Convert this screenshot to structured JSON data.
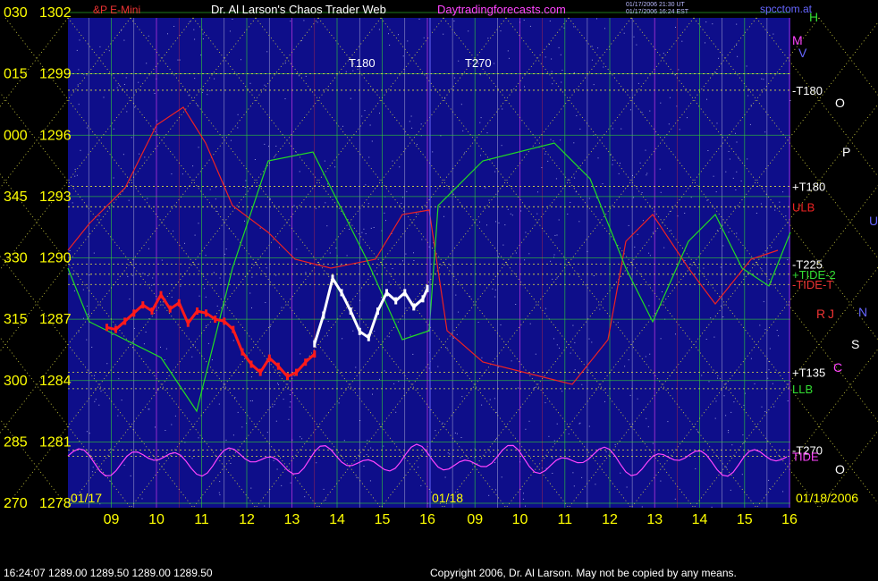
{
  "header": {
    "symbol": "&P E-Mini",
    "title": "Dr. Al Larson's Chaos Trader Web",
    "site": "Daytradingforecasts.com",
    "stamp1": "01/17/2006 21:30 UT",
    "stamp2": "01/17/2006 16:24 EST",
    "corner": "spcctom.at"
  },
  "footer": {
    "quote": "16:24:07  1289.00  1289.50  1289.00  1289.50",
    "copyright": "Copyright 2006, Dr. Al Larson. May not be copied by any means."
  },
  "colors": {
    "background": "#000000",
    "plot_bg": "#0e0e8a",
    "axis_text": "#ffff00",
    "price_red": "#ff1a1a",
    "price_white": "#ffffff",
    "tide_green": "#22dd22",
    "tide_red": "#ee2222",
    "magenta": "#ff44ff",
    "grid_yellow": "#dddd44"
  },
  "chart_data": {
    "type": "line",
    "title": "Dr. Al Larson's Chaos Trader Web",
    "y_axis": {
      "ylim": [
        1278,
        1302
      ],
      "ticks": [
        {
          "deg": "030",
          "price": "1302",
          "value": 1302
        },
        {
          "deg": "015",
          "price": "1299",
          "value": 1299
        },
        {
          "deg": "000",
          "price": "1296",
          "value": 1296
        },
        {
          "deg": "345",
          "price": "1293",
          "value": 1293
        },
        {
          "deg": "330",
          "price": "1290",
          "value": 1290
        },
        {
          "deg": "315",
          "price": "1287",
          "value": 1287
        },
        {
          "deg": "300",
          "price": "1284",
          "value": 1284
        },
        {
          "deg": "285",
          "price": "1281",
          "value": 1281
        },
        {
          "deg": "270",
          "price": "1278",
          "value": 1278
        }
      ]
    },
    "x_axis": {
      "days": [
        "01/17",
        "01/18"
      ],
      "end_date": "01/18/2006",
      "hours_day1": [
        "09",
        "10",
        "11",
        "12",
        "13",
        "14",
        "15",
        "16"
      ],
      "hours_day2": [
        "09",
        "10",
        "11",
        "12",
        "13",
        "14",
        "15",
        "16"
      ]
    },
    "series": [
      {
        "color": "#ff1a1a",
        "x": [
          8.9,
          9.1,
          9.3,
          9.5,
          9.7,
          9.9,
          10.1,
          10.3,
          10.5,
          10.7,
          10.9,
          11.1,
          11.3,
          11.5,
          11.7,
          11.9,
          12.1,
          12.3,
          12.5,
          12.7,
          12.9,
          13.1,
          13.3,
          13.5
        ],
        "y": [
          1286.6,
          1286.5,
          1286.9,
          1287.3,
          1287.7,
          1287.4,
          1288.2,
          1287.5,
          1287.8,
          1286.8,
          1287.4,
          1287.3,
          1287.0,
          1286.9,
          1286.5,
          1285.4,
          1284.8,
          1284.4,
          1285.1,
          1284.7,
          1284.2,
          1284.4,
          1284.9,
          1285.3
        ]
      },
      {
        "color": "#ffffff",
        "x": [
          13.5,
          13.7,
          13.9,
          14.1,
          14.3,
          14.5,
          14.7,
          14.9,
          15.1,
          15.3,
          15.5,
          15.7,
          15.9,
          16.0
        ],
        "y": [
          1285.8,
          1287.2,
          1289.0,
          1288.3,
          1287.4,
          1286.4,
          1286.1,
          1287.4,
          1288.3,
          1287.9,
          1288.3,
          1287.6,
          1288.0,
          1288.5
        ]
      }
    ],
    "lines": [
      {
        "label": "T180",
        "value": 1299.0
      },
      {
        "label": "T270",
        "value": 1299.0
      },
      {
        "label": "-T180",
        "value": 1298.2
      },
      {
        "label": "+T180",
        "value": 1293.5
      },
      {
        "label": "ULB",
        "value": 1292.5
      },
      {
        "label": "-T225",
        "value": 1289.7
      },
      {
        "label": "+TIDE-2",
        "value": 1289.2
      },
      {
        "label": "-TIDE-T",
        "value": 1288.7
      },
      {
        "label": "+T135",
        "value": 1284.4
      },
      {
        "label": "LLB",
        "value": 1283.6
      },
      {
        "label": "-T270",
        "value": 1280.6
      },
      {
        "label": "TIDE",
        "value": 1280.3
      }
    ],
    "planet_markers": [
      "H",
      "M",
      "V",
      "O",
      "P",
      "U",
      "N",
      "R",
      "J",
      "S",
      "C",
      "O"
    ]
  }
}
